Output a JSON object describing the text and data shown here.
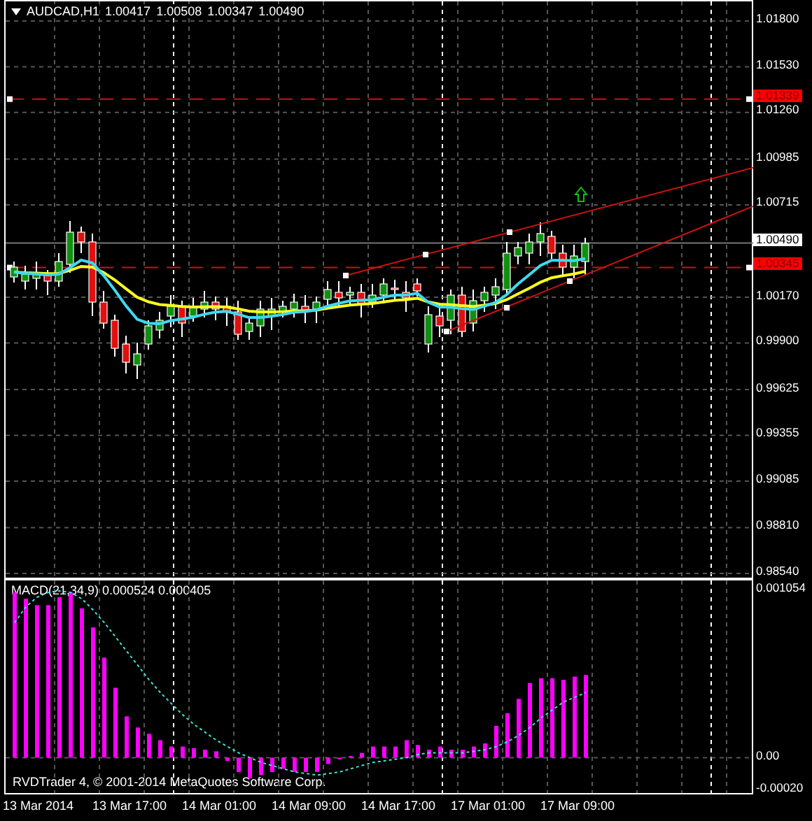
{
  "main_chart": {
    "symbol": "AUDCAD,H1",
    "prices": [
      "1.00417",
      "1.00508",
      "1.00347",
      "1.00490"
    ],
    "price_axis": [
      "1.01800",
      "1.01530",
      "1.01260",
      "1.00985",
      "1.00715",
      "1.00170",
      "0.99900",
      "0.99625",
      "0.99355",
      "0.99085",
      "0.98810",
      "0.98540"
    ],
    "bid_label": "1.00490",
    "levels": [
      {
        "label": "1.01339"
      },
      {
        "label": "1.00345"
      }
    ]
  },
  "macd": {
    "title": "MACD(21,34,9) 0.000524 0.000405",
    "chart_data": {
      "type": "bar",
      "grid": true,
      "ylim": [
        -0.000205,
        0.001054
      ],
      "yticks": [
        {
          "value": 0.001054,
          "label": "0.001054"
        },
        {
          "value": 0,
          "label": "0.00"
        },
        {
          "value": -0.000205,
          "label": "-0.00020"
        }
      ],
      "series": [
        {
          "color": "#ff00ff",
          "values": [
            0.00104,
            0.001,
            0.00096,
            0.00096,
            0.00101,
            0.00104,
            0.00094,
            0.00082,
            0.00063,
            0.00044,
            0.00026,
            0.00019,
            0.00015,
            0.00011,
            7e-05,
            7e-05,
            6e-05,
            5e-05,
            4e-05,
            -2e-05,
            -9e-05,
            -0.00013,
            -0.00011,
            -9e-05,
            -7e-05,
            -9e-05,
            -9e-05,
            -9e-05,
            -4e-05,
            -1e-05,
            1e-05,
            3e-05,
            7e-05,
            7e-05,
            7e-05,
            0.00011,
            8e-05,
            5e-05,
            7e-05,
            5e-05,
            5e-05,
            7e-05,
            9e-05,
            0.0002,
            0.00028,
            0.00037,
            0.00047,
            0.0005,
            0.0005,
            0.00049,
            0.00051,
            0.00052
          ]
        },
        {
          "color": "#40e0d0",
          "type": "line",
          "line_style": "dashed",
          "values": [
            0.00085,
            0.00095,
            0.00101,
            0.00104,
            0.00105,
            0.00104,
            0.001,
            0.00093,
            0.00085,
            0.00076,
            0.00067,
            0.00058,
            0.00049,
            0.00041,
            0.00034,
            0.00027,
            0.00021,
            0.00016,
            0.00011,
            7e-05,
            3e-05,
            0,
            -3e-05,
            -5e-05,
            -7e-05,
            -9e-05,
            -0.0001,
            -0.00011,
            -0.0001,
            -9e-05,
            -7e-05,
            -5e-05,
            -3e-05,
            -2e-05,
            -1e-05,
            0,
            2e-05,
            3e-05,
            3e-05,
            3e-05,
            3e-05,
            4e-05,
            5e-05,
            7e-05,
            0.0001,
            0.00014,
            0.00019,
            0.00025,
            0.0003,
            0.00035,
            0.00038,
            0.00041
          ]
        }
      ]
    },
    "copyright": "RVDTrader 4, © 2001-2014 MetaQuotes Software Corp."
  },
  "time_axis": [
    "13 Mar 2014",
    "13 Mar 17:00",
    "14 Mar 01:00",
    "14 Mar 09:00",
    "14 Mar 17:00",
    "17 Mar 01:00",
    "17 Mar 09:00"
  ]
}
